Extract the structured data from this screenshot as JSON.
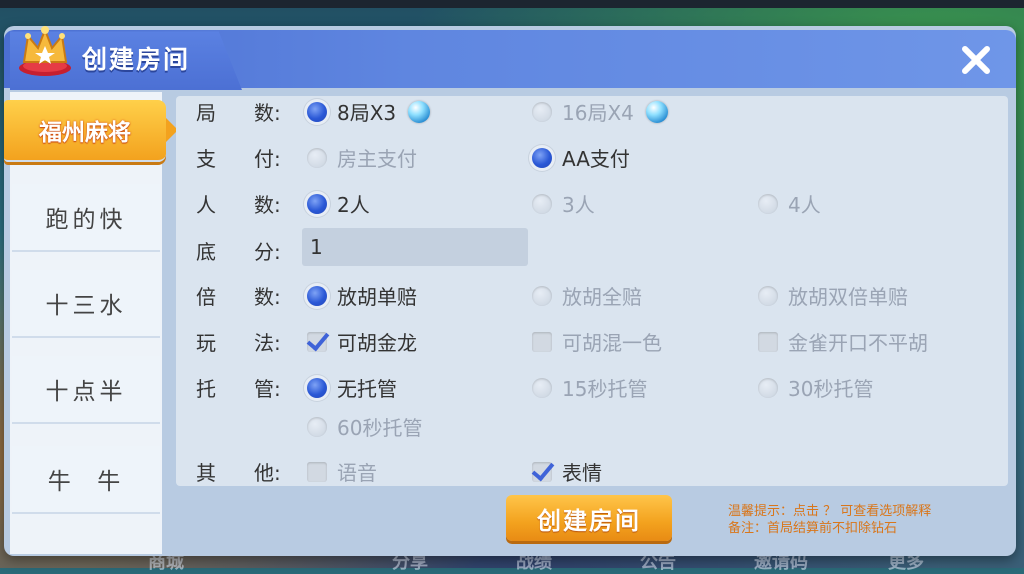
{
  "dialog": {
    "title": "创建房间",
    "close_icon": "close-icon"
  },
  "sidebar": {
    "items": [
      {
        "label": "福州麻将",
        "active": true
      },
      {
        "label": "跑的快"
      },
      {
        "label": "十三水"
      },
      {
        "label": "十点半"
      },
      {
        "label": "牛  牛"
      }
    ]
  },
  "rows": {
    "rounds": {
      "label_a": "局",
      "label_b": "数:",
      "options": [
        "8局X3",
        "16局X4"
      ],
      "selected": 0
    },
    "payment": {
      "label_a": "支",
      "label_b": "付:",
      "options": [
        "房主支付",
        "AA支付"
      ],
      "selected": 1
    },
    "players": {
      "label_a": "人",
      "label_b": "数:",
      "options": [
        "2人",
        "3人",
        "4人"
      ],
      "selected": 0
    },
    "base_score": {
      "label_a": "底",
      "label_b": "分:",
      "value": "1"
    },
    "multiplier": {
      "label_a": "倍",
      "label_b": "数:",
      "options": [
        "放胡单赔",
        "放胡全赔",
        "放胡双倍单赔"
      ],
      "selected": 0
    },
    "gameplay": {
      "label_a": "玩",
      "label_b": "法:",
      "options": [
        "可胡金龙",
        "可胡混一色",
        "金雀开口不平胡"
      ],
      "checked": [
        true,
        false,
        false
      ]
    },
    "auto_play": {
      "label_a": "托",
      "label_b": "管:",
      "options": [
        "无托管",
        "15秒托管",
        "30秒托管",
        "60秒托管"
      ],
      "selected": 0
    },
    "other": {
      "label_a": "其",
      "label_b": "他:",
      "options": [
        "语音",
        "表情"
      ],
      "checked": [
        false,
        true
      ]
    }
  },
  "create_button": {
    "label": "创建房间"
  },
  "hints": {
    "line1": "温馨提示：点击 ？  可查看选项解释",
    "line2": "备注：首局结算前不扣除钻石"
  },
  "bottom_nav": [
    "商城",
    "分享",
    "战绩",
    "公告",
    "邀请码",
    "更多"
  ],
  "colors": {
    "accent_blue": "#3f63d8",
    "accent_orange": "#f3a21e",
    "hint_orange": "#d9761a"
  }
}
